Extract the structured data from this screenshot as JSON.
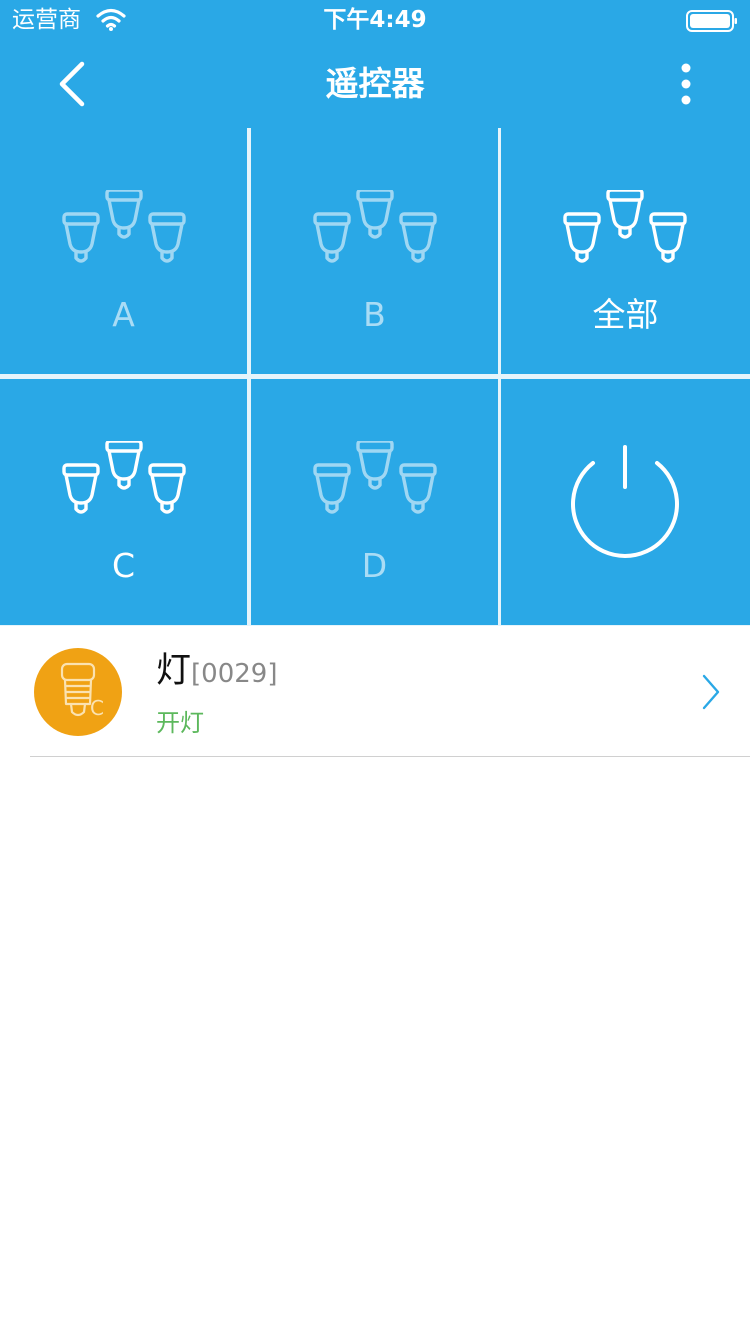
{
  "status_bar": {
    "carrier": "运营商",
    "time": "下午4:49",
    "icons": [
      "wifi-icon",
      "battery-icon"
    ]
  },
  "nav": {
    "title": "遥控器",
    "back_icon": "chevron-left-icon",
    "more_icon": "more-vertical-icon"
  },
  "tiles": [
    {
      "label": "A",
      "icon": "bulb-group-icon",
      "active": false
    },
    {
      "label": "B",
      "icon": "bulb-group-icon",
      "active": false
    },
    {
      "label": "全部",
      "icon": "bulb-group-icon",
      "active": true
    },
    {
      "label": "C",
      "icon": "bulb-group-icon",
      "active": true
    },
    {
      "label": "D",
      "icon": "bulb-group-icon",
      "active": false
    },
    {
      "label": "",
      "icon": "power-icon",
      "active": true
    }
  ],
  "device": {
    "name": "灯",
    "code": "[0029]",
    "status": "开灯",
    "avatar_badge": "C",
    "avatar_icon": "bulb-icon",
    "chevron_icon": "chevron-right-icon"
  },
  "colors": {
    "accent": "#2aa8e6",
    "avatar": "#f0a214",
    "status_on": "#5cb85c"
  }
}
